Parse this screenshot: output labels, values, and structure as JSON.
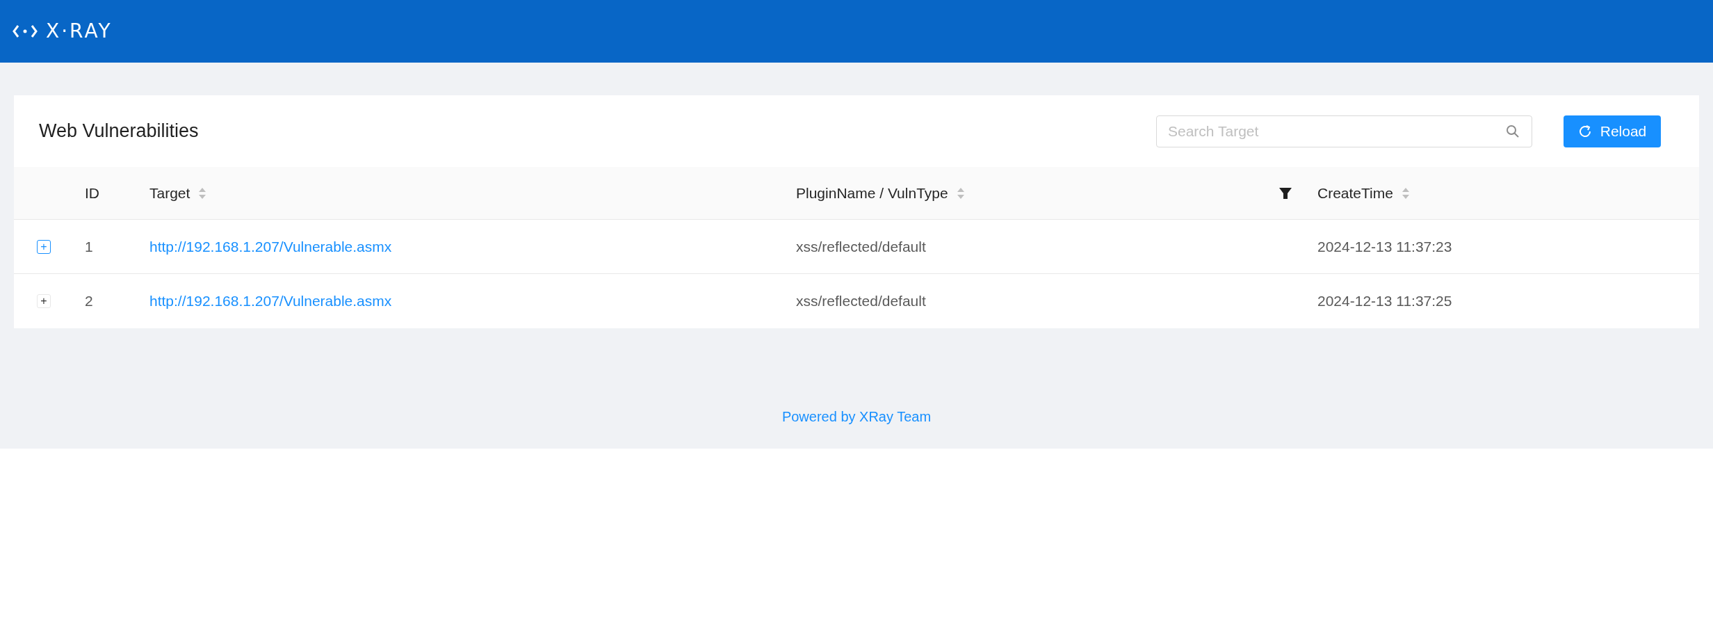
{
  "header": {
    "logo_text": "X·RAY"
  },
  "card": {
    "title": "Web Vulnerabilities",
    "search": {
      "placeholder": "Search Target"
    },
    "reload_button": "Reload"
  },
  "table": {
    "columns": [
      {
        "label": "ID",
        "sortable": false,
        "filterable": false
      },
      {
        "label": "Target",
        "sortable": true,
        "filterable": false
      },
      {
        "label": "PluginName / VulnType",
        "sortable": true,
        "filterable": true
      },
      {
        "label": "CreateTime",
        "sortable": true,
        "filterable": false
      }
    ],
    "rows": [
      {
        "expand": "+",
        "focused": true,
        "id": "1",
        "target": "http://192.168.1.207/Vulnerable.asmx",
        "plugin": "xss/reflected/default",
        "create_time": "2024-12-13 11:37:23"
      },
      {
        "expand": "+",
        "focused": false,
        "id": "2",
        "target": "http://192.168.1.207/Vulnerable.asmx",
        "plugin": "xss/reflected/default",
        "create_time": "2024-12-13 11:37:25"
      }
    ]
  },
  "footer": {
    "text": "Powered by XRay Team"
  }
}
